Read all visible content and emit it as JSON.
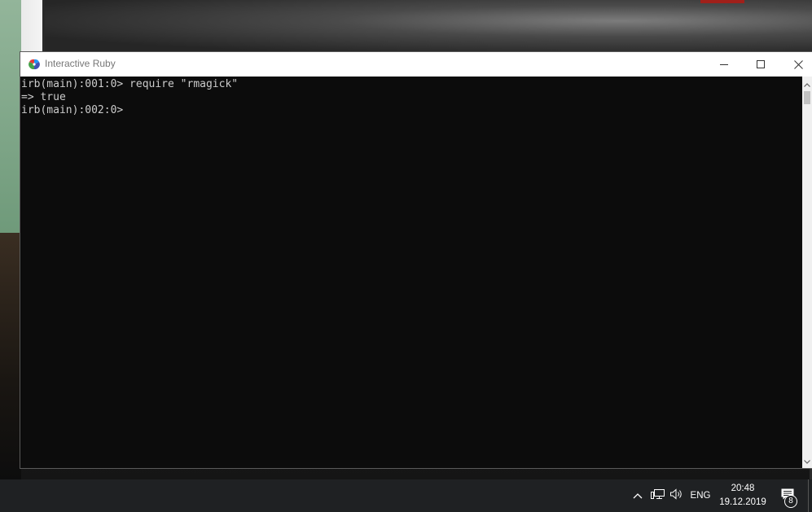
{
  "window": {
    "title": "Interactive Ruby",
    "icon": "ruby-rgb-icon",
    "controls": {
      "minimize": "minimize-icon",
      "maximize": "maximize-icon",
      "close": "close-icon"
    }
  },
  "console": {
    "lines": [
      "irb(main):001:0> require \"rmagick\"",
      "=> true",
      "irb(main):002:0>"
    ],
    "background": "#0c0c0c",
    "foreground": "#cccccc"
  },
  "taskbar": {
    "tray": {
      "chevron": "chevron-up-icon",
      "network": "network-icon",
      "volume": "volume-icon",
      "language": "ENG"
    },
    "clock": {
      "time": "20:48",
      "date": "19.12.2019"
    },
    "notifications": {
      "icon": "action-center-icon",
      "count": "8"
    },
    "background": "#1f2123"
  }
}
